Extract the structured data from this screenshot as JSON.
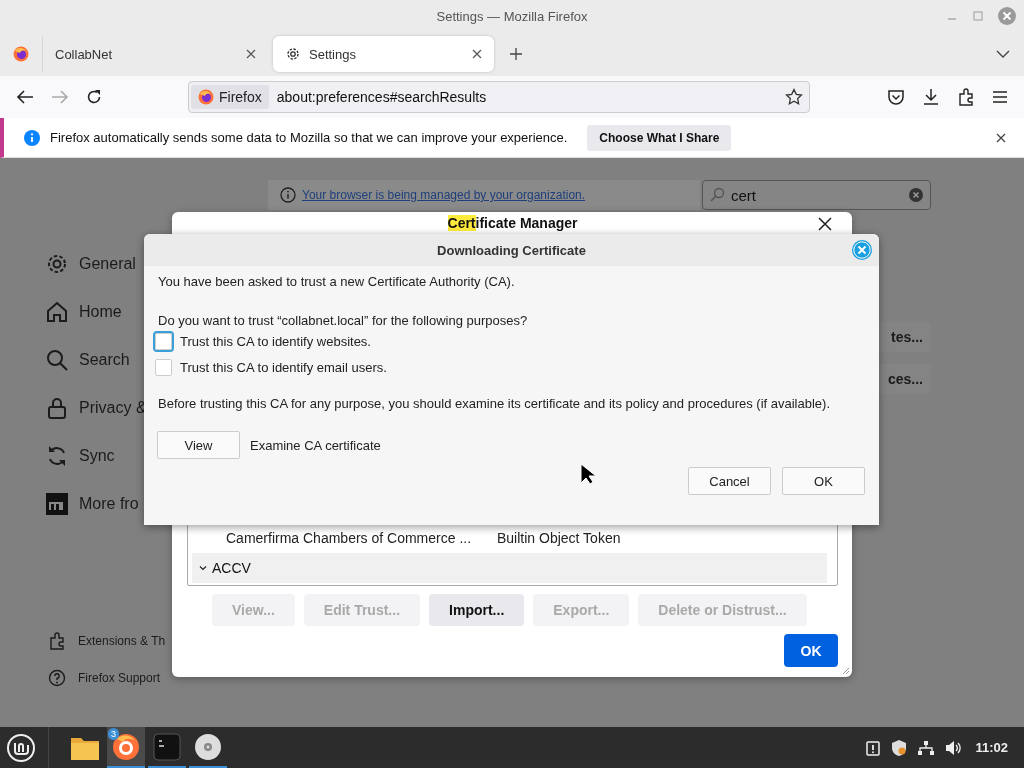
{
  "window": {
    "title": "Settings — Mozilla Firefox"
  },
  "tabs": [
    {
      "label": "CollabNet",
      "selected": false
    },
    {
      "label": "Settings",
      "selected": true
    }
  ],
  "address_bar": {
    "identity": "Firefox",
    "url": "about:preferences#searchResults"
  },
  "notification": {
    "message": "Firefox automatically sends some data to Mozilla so that we can improve your experience.",
    "button": "Choose What I Share"
  },
  "settings": {
    "managed_notice": "Your browser is being managed by your organization.",
    "search": {
      "value": "cert"
    },
    "sidebar": [
      {
        "label": "General"
      },
      {
        "label": "Home"
      },
      {
        "label": "Search"
      },
      {
        "label": "Privacy &"
      },
      {
        "label": "Sync"
      },
      {
        "label": "More fro"
      }
    ],
    "footer_links": [
      "Extensions & Th",
      "Firefox Support"
    ],
    "buttons": [
      "tes...",
      "ces..."
    ]
  },
  "certificate_manager": {
    "title_match": "Cert",
    "title_rest": "ificate Manager",
    "rows": [
      {
        "kind": "cert",
        "name": "Camerfirma Chambers of Commerce ...",
        "device": "Builtin Object Token"
      },
      {
        "kind": "group",
        "name": "ACCV",
        "expanded": true
      }
    ],
    "buttons": [
      {
        "label": "View...",
        "disabled": true
      },
      {
        "label": "Edit Trust...",
        "disabled": true
      },
      {
        "label": "Import...",
        "disabled": false
      },
      {
        "label": "Export...",
        "disabled": true
      },
      {
        "label": "Delete or Distrust...",
        "disabled": true
      }
    ],
    "ok": "OK"
  },
  "download_dialog": {
    "title": "Downloading Certificate",
    "intro": "You have been asked to trust a new Certificate Authority (CA).",
    "question": "Do you want to trust “collabnet.local” for the following purposes?",
    "options": [
      {
        "label": "Trust this CA to identify websites.",
        "checked": false,
        "focused": true
      },
      {
        "label": "Trust this CA to identify email users.",
        "checked": false,
        "focused": false
      }
    ],
    "warning": "Before trusting this CA for any purpose, you should examine its certificate and its policy and procedures (if available).",
    "view_button": "View",
    "view_label": "Examine CA certificate",
    "buttons": [
      "Cancel",
      "OK"
    ]
  },
  "taskbar": {
    "apps": [
      {
        "running": false,
        "active": false
      },
      {
        "running": true,
        "active": true,
        "badge": "3"
      },
      {
        "running": true,
        "active": false
      },
      {
        "running": true,
        "active": false
      }
    ],
    "clock": "11:02"
  }
}
